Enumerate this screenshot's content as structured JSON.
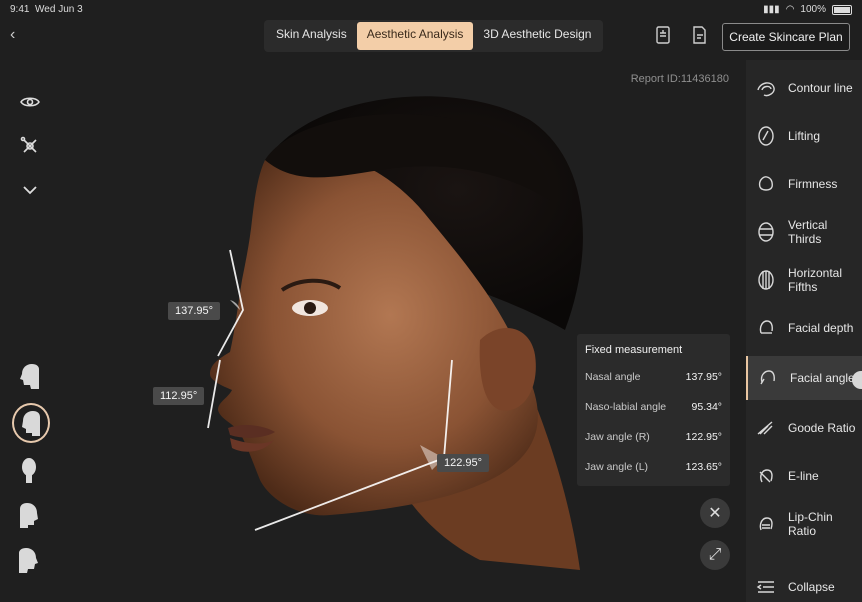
{
  "status": {
    "time": "9:41",
    "date": "Wed Jun 3",
    "battery": "100%"
  },
  "tabs": [
    {
      "label": "Skin Analysis",
      "active": false
    },
    {
      "label": "Aesthetic Analysis",
      "active": true
    },
    {
      "label": "3D Aesthetic Design",
      "active": false
    }
  ],
  "actions": {
    "plan_label": "Create Skincare Plan"
  },
  "report": {
    "text": "Report ID:11436180"
  },
  "angles": {
    "nasal": "137.95°",
    "naso_labial": "112.95°",
    "jaw": "122.95°"
  },
  "panel": {
    "title": "Fixed measurement",
    "rows": [
      {
        "label": "Nasal angle",
        "value": "137.95°"
      },
      {
        "label": "Naso-labial angle",
        "value": "95.34°"
      },
      {
        "label": "Jaw angle (R)",
        "value": "122.95°"
      },
      {
        "label": "Jaw angle (L)",
        "value": "123.65°"
      }
    ]
  },
  "sidebar": {
    "items": [
      {
        "label": "Contour line",
        "icon": "contour-icon"
      },
      {
        "label": "Lifting",
        "icon": "lifting-icon"
      },
      {
        "label": "Firmness",
        "icon": "firmness-icon"
      },
      {
        "label": "Vertical Thirds",
        "icon": "vertical-thirds-icon"
      },
      {
        "label": "Horizontal Fifths",
        "icon": "horizontal-fifths-icon"
      },
      {
        "label": "Facial depth",
        "icon": "facial-depth-icon"
      },
      {
        "label": "Facial angles",
        "icon": "facial-angles-icon",
        "active": true
      },
      {
        "label": "Goode Ratio",
        "icon": "goode-ratio-icon"
      },
      {
        "label": "E-line",
        "icon": "e-line-icon"
      },
      {
        "label": "Lip-Chin Ratio",
        "icon": "lip-chin-icon"
      }
    ],
    "collapse_label": "Collapse"
  },
  "colors": {
    "accent": "#f3cea8",
    "background": "#1f1f1f",
    "panel": "#2d2d2d"
  }
}
